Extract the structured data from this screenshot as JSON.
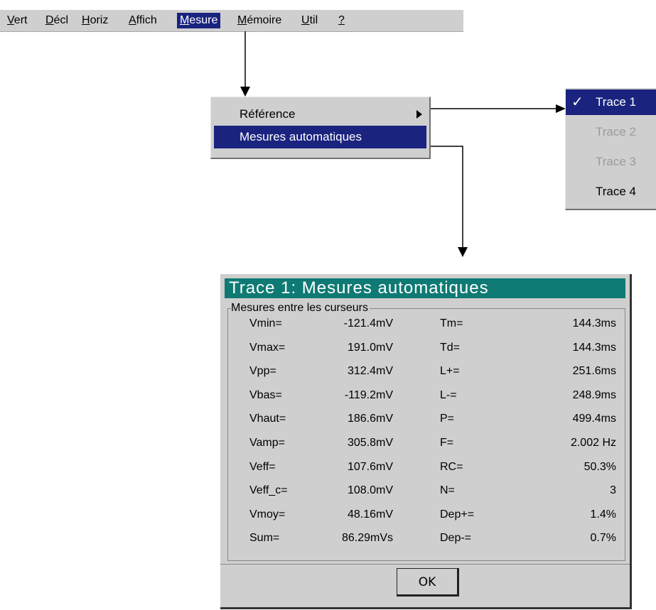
{
  "menubar": {
    "items": [
      {
        "pre": "",
        "ul": "V",
        "post": "ert"
      },
      {
        "pre": "",
        "ul": "D",
        "post": "écl"
      },
      {
        "pre": "",
        "ul": "H",
        "post": "oriz"
      },
      {
        "pre": "",
        "ul": "A",
        "post": "ffich"
      },
      {
        "pre": "",
        "ul": "M",
        "post": "esure"
      },
      {
        "pre": "",
        "ul": "M",
        "post": "émoire"
      },
      {
        "pre": "",
        "ul": "U",
        "post": "til"
      },
      {
        "pre": "",
        "ul": "?",
        "post": ""
      }
    ],
    "active_index": 4
  },
  "dropdown": {
    "items": [
      "Référence",
      "Mesures automatiques"
    ],
    "selected_index": 1
  },
  "trace_menu": {
    "items": [
      "Trace 1",
      "Trace 2",
      "Trace 3",
      "Trace 4"
    ],
    "checkmark": "✓",
    "selected_index": 0,
    "disabled": [
      1,
      2
    ]
  },
  "dialog": {
    "title": "Trace 1: Mesures automatiques",
    "group_label": "Mesures entre les curseurs",
    "rows": [
      {
        "l1": "Vmin=",
        "v1": "-121.4mV",
        "l2": "Tm=",
        "v2": "144.3ms"
      },
      {
        "l1": "Vmax=",
        "v1": "191.0mV",
        "l2": "Td=",
        "v2": "144.3ms"
      },
      {
        "l1": "Vpp=",
        "v1": "312.4mV",
        "l2": "L+=",
        "v2": "251.6ms"
      },
      {
        "l1": "Vbas=",
        "v1": "-119.2mV",
        "l2": "L-=",
        "v2": "248.9ms"
      },
      {
        "l1": "Vhaut=",
        "v1": "186.6mV",
        "l2": "P=",
        "v2": "499.4ms"
      },
      {
        "l1": "Vamp=",
        "v1": "305.8mV",
        "l2": "F=",
        "v2": "2.002 Hz"
      },
      {
        "l1": "Veff=",
        "v1": "107.6mV",
        "l2": "RC=",
        "v2": "50.3%"
      },
      {
        "l1": "Veff_c=",
        "v1": "108.0mV",
        "l2": "N=",
        "v2": "3"
      },
      {
        "l1": "Vmoy=",
        "v1": "48.16mV",
        "l2": "Dep+=",
        "v2": "1.4%"
      },
      {
        "l1": "Sum=",
        "v1": "86.29mVs",
        "l2": "Dep-=",
        "v2": "0.7%"
      }
    ],
    "ok_label": "OK"
  },
  "colors": {
    "menu_bg": "#cfcfcf",
    "selection": "#1a237e",
    "title_bg": "#0f7a74",
    "disabled_text": "#9c9c9c"
  }
}
